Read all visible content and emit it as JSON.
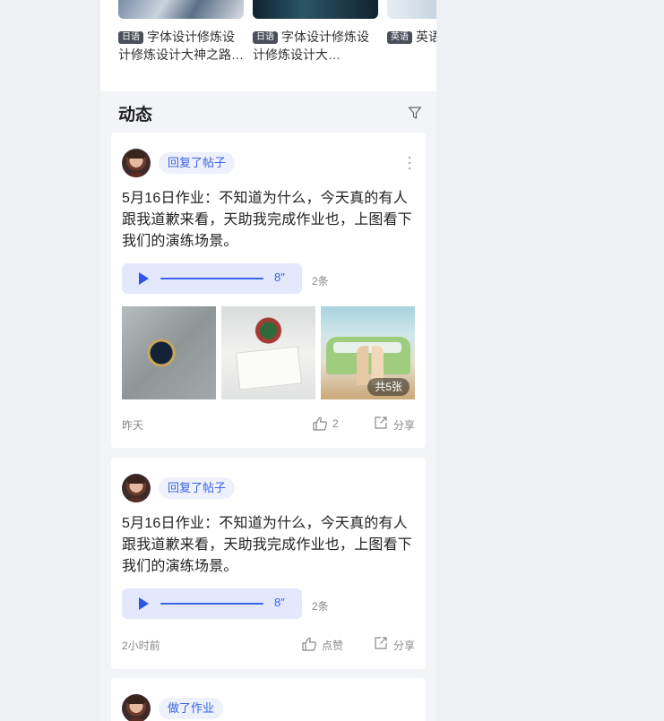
{
  "courses": [
    {
      "tag": "日语",
      "title": "字体设计修炼设计修炼设计大神之路…"
    },
    {
      "tag": "日语",
      "title": "字体设计修炼设计修炼设计大…"
    },
    {
      "tag": "英语",
      "title": "英语"
    }
  ],
  "feed": {
    "title": "动态",
    "filter_icon": "filter-icon"
  },
  "posts": [
    {
      "action": "回复了帖子",
      "text": "5月16日作业：不知道为什么，今天真的有人跟我道歉来看，天助我完成作业也，上图看下我们的演练场景。",
      "audio_duration": "8″",
      "reply_count": "2条",
      "photo_count": "共5张",
      "time": "昨天",
      "likes": "2",
      "share": "分享"
    },
    {
      "action": "回复了帖子",
      "text": "5月16日作业：不知道为什么，今天真的有人跟我道歉来看，天助我完成作业也，上图看下我们的演练场景。",
      "audio_duration": "8″",
      "reply_count": "2条",
      "time": "2小时前",
      "likes": "点赞",
      "share": "分享"
    },
    {
      "action": "做了作业"
    }
  ],
  "colors": {
    "accent": "#3a63e8",
    "chip_bg": "#eef1fb",
    "audio_bg": "#e3e8fd",
    "page_bg": "#f3f4f7"
  }
}
